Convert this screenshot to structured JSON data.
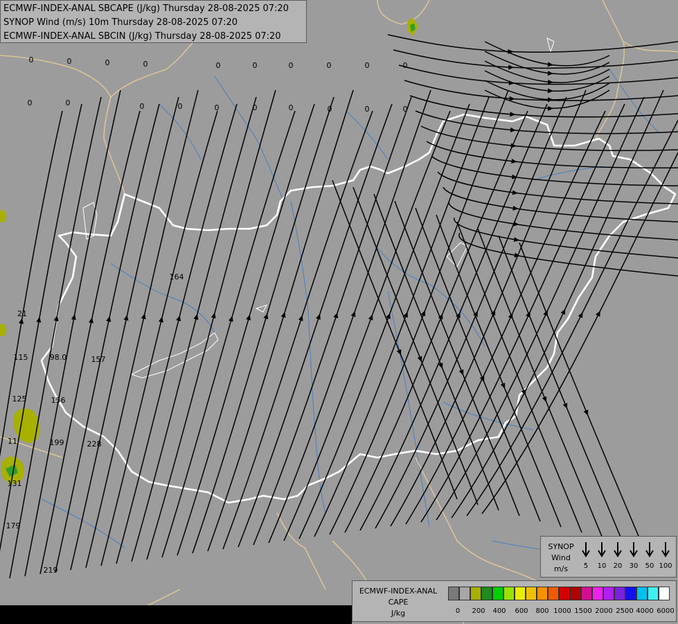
{
  "title_lines": [
    "ECMWF-INDEX-ANAL SBCAPE (J/kg) Thursday 28-08-2025 07:20",
    "SYNOP Wind (m/s) 10m Thursday 28-08-2025 07:20",
    "ECMWF-INDEX-ANAL SBCIN (J/kg) Thursday 28-08-2025 07:20"
  ],
  "colors": {
    "background": "#9c9c9c",
    "border_white": "#ffffff",
    "border_tan": "#d8c49a",
    "river": "#4a7fc0",
    "streamline": "#000000",
    "cape_low_fill": "#a8b000",
    "cape_mid_fill": "#2f9e2f"
  },
  "wind_legend": {
    "title1": "SYNOP",
    "title2": "Wind",
    "unit": "m/s",
    "speeds": [
      "5",
      "10",
      "20",
      "30",
      "50",
      "100"
    ]
  },
  "cape_legend": {
    "title1": "ECMWF-INDEX-ANAL",
    "title2": "CAPE",
    "unit": "J/kg",
    "labels": [
      "0",
      "200",
      "400",
      "600",
      "800",
      "1000",
      "1500",
      "2000",
      "2500",
      "4000",
      "6000"
    ],
    "colors": [
      "#7a7a7a",
      "#a6a6a6",
      "#a8b000",
      "#1e8c1e",
      "#00d000",
      "#9ae000",
      "#ecec00",
      "#f0c000",
      "#f89000",
      "#f05a00",
      "#d20000",
      "#b00000",
      "#d01090",
      "#f020f0",
      "#b020f0",
      "#7a20e0",
      "#1010f0",
      "#00c0f0",
      "#40f0f0",
      "#ffffff"
    ]
  },
  "map_labels": [
    "0",
    "0",
    "0",
    "0",
    "0",
    "0",
    "0",
    "0",
    "0",
    "0",
    "0",
    "0",
    "0",
    "0",
    "0",
    "0",
    "0",
    "0",
    "0",
    "0",
    "164",
    "21",
    "115",
    "98.0",
    "157",
    "125",
    "156",
    "11",
    "199",
    "228",
    "131",
    "179",
    "219"
  ]
}
